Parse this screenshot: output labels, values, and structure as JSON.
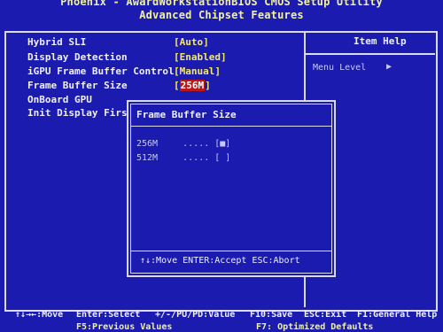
{
  "header": {
    "line1": "Phoenix - AwardWorkstationBIOS CMOS Setup Utility",
    "line2": "Advanced Chipset Features"
  },
  "settings": [
    {
      "label": "Hybrid SLI",
      "value": "[Auto]"
    },
    {
      "label": "Display Detection",
      "value": "[Enabled]"
    },
    {
      "label": "iGPU Frame Buffer Control",
      "value": "[Manual]"
    },
    {
      "label": "Frame Buffer Size",
      "value_prefix": "[",
      "value_highlight": "256M",
      "value_suffix": "]"
    },
    {
      "label": "OnBoard GPU",
      "value": ""
    },
    {
      "label": "Init Display Firs",
      "value": ""
    }
  ],
  "help": {
    "title": "Item Help",
    "menu_level": "Menu Level",
    "menu_arrow": "▶"
  },
  "popup": {
    "title": "Frame Buffer Size",
    "options": [
      {
        "label": "256M",
        "dots": ".....",
        "mark": "[■]"
      },
      {
        "label": "512M",
        "dots": ".....",
        "mark": "[ ]"
      }
    ],
    "footer": "↑↓:Move ENTER:Accept ESC:Abort"
  },
  "footer": {
    "row1": [
      {
        "text": "↑↓→←:Move"
      },
      {
        "text": "Enter:Select"
      },
      {
        "text": "+/-/PU/PD:Value"
      },
      {
        "text": "F10:Save"
      },
      {
        "text": "ESC:Exit"
      },
      {
        "text": "F1:General Help"
      }
    ],
    "row2": [
      {
        "text": "F5:Previous Values"
      },
      {
        "text": "F7: Optimized Defaults"
      }
    ]
  }
}
